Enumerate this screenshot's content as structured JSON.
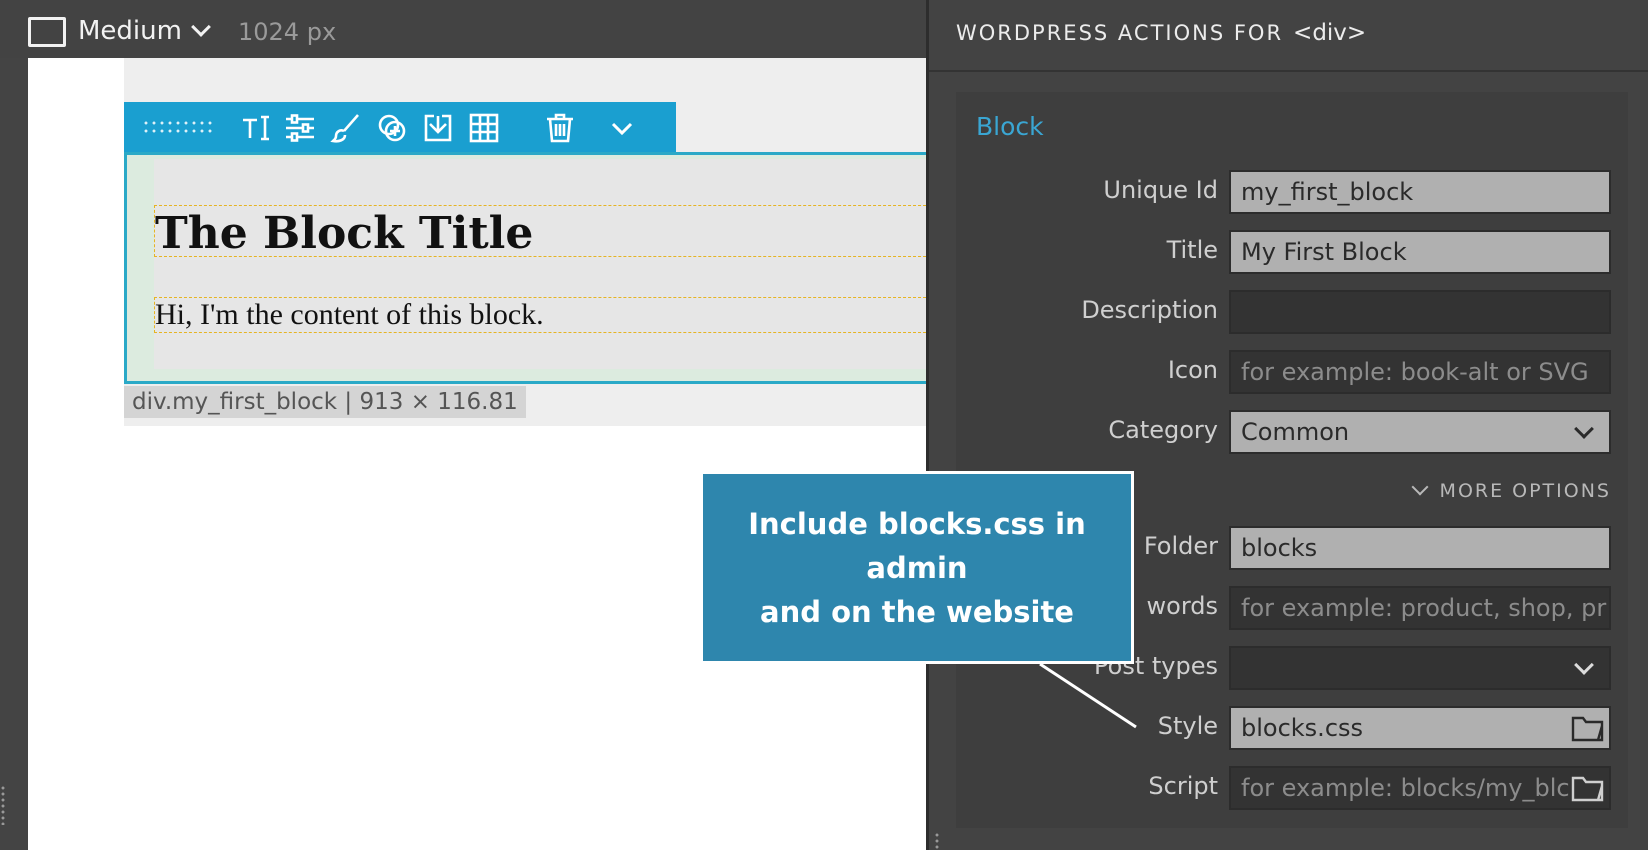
{
  "topbar": {
    "device_label": "Medium",
    "width_label": "1024 px"
  },
  "canvas": {
    "block_title": "The Block Title",
    "block_content": "Hi, I'm the content of this block.",
    "size_badge": "div.my_first_block | 913 × 116.81",
    "toolbar_icons": [
      "text-icon",
      "sliders-icon",
      "brush-icon",
      "add-circle-icon",
      "insert-icon",
      "grid-icon",
      "trash-icon",
      "chevron-down-icon"
    ]
  },
  "panel": {
    "title_prefix": "WordPress Actions for",
    "title_tag": "<div>",
    "section_title": "Block",
    "more_options": "MORE OPTIONS",
    "fields": {
      "unique_id": {
        "label": "Unique Id",
        "value": "my_first_block"
      },
      "title": {
        "label": "Title",
        "value": "My First Block"
      },
      "description": {
        "label": "Description",
        "value": ""
      },
      "icon": {
        "label": "Icon",
        "placeholder": "for example: book-alt or SVG"
      },
      "category": {
        "label": "Category",
        "value": "Common"
      },
      "folder": {
        "label": "Folder",
        "value": "blocks"
      },
      "keywords": {
        "label": "words",
        "placeholder": "for example: product, shop, pr"
      },
      "post_types": {
        "label": "Post types",
        "value": ""
      },
      "style": {
        "label": "Style",
        "value": "blocks.css"
      },
      "script": {
        "label": "Script",
        "placeholder": "for example: blocks/my_blc"
      }
    }
  },
  "callout": {
    "line1": "Include blocks.css in admin",
    "line2": "and on the website"
  },
  "colors": {
    "toolbar_accent": "#1a9fd0",
    "section_title": "#3aa6d3",
    "callout_bg": "#2e86ad",
    "guide_dashed": "#e6b422"
  }
}
